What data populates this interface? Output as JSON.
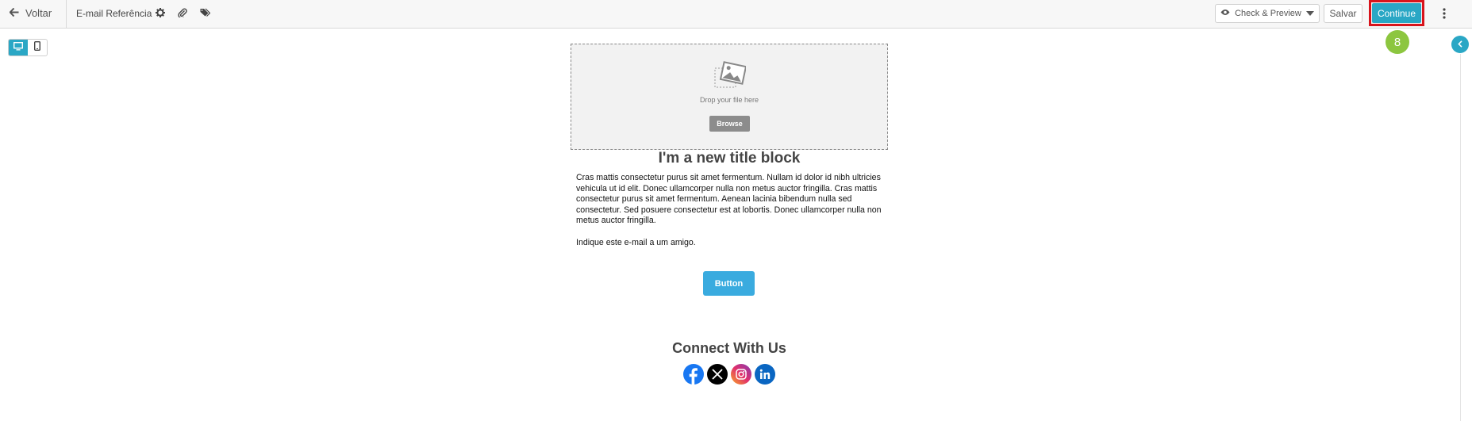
{
  "toolbar": {
    "back_label": "Voltar",
    "document_title": "E-mail Referência",
    "check_preview_label": "Check & Preview",
    "save_label": "Salvar",
    "continue_label": "Continue",
    "accent_color": "#2aa7c5",
    "highlight_color": "#d8141c"
  },
  "step_badge": {
    "number": "8",
    "color": "#8cc63f"
  },
  "device_toggle": {
    "active": "desktop",
    "options": [
      "desktop-icon",
      "mobile-icon"
    ]
  },
  "email": {
    "dropzone": {
      "text": "Drop your file here",
      "browse_label": "Browse"
    },
    "title": "I'm a new title block",
    "paragraphs": [
      "Cras mattis consectetur purus sit amet fermentum. Nullam id dolor id nibh ultricies vehicula ut id elit. Donec ullamcorper nulla non metus auctor fringilla. Cras mattis consectetur purus sit amet fermentum. Aenean lacinia bibendum nulla sed consectetur. Sed posuere consectetur est at lobortis. Donec ullamcorper nulla non metus auctor fringilla.",
      "Indique este e-mail a um amigo."
    ],
    "button_label": "Button",
    "button_color": "#3aabdf",
    "connect_title": "Connect With Us",
    "social_icons": [
      "facebook-icon",
      "x-icon",
      "instagram-icon",
      "linkedin-icon"
    ]
  }
}
